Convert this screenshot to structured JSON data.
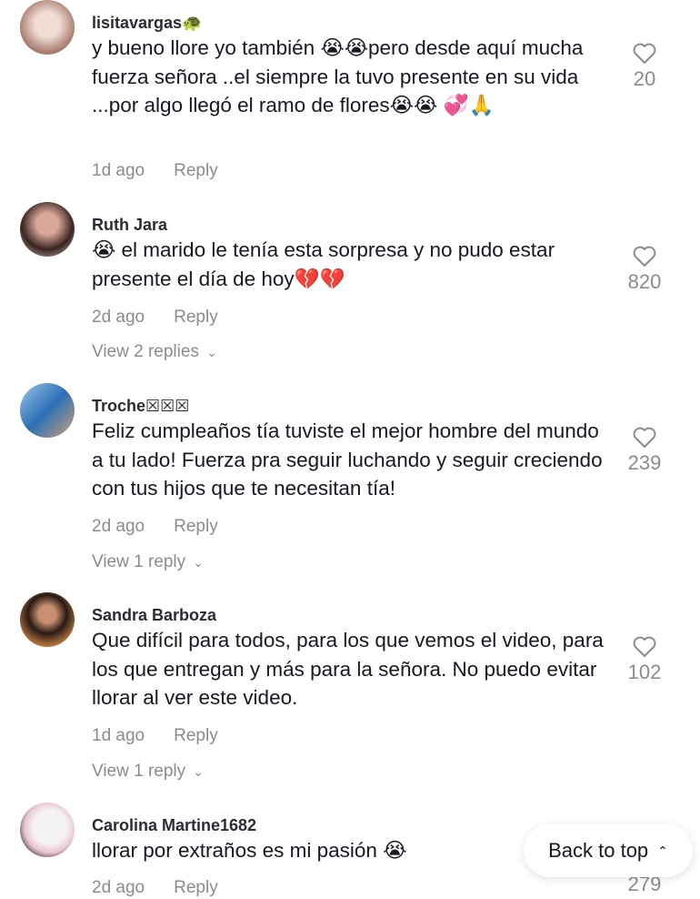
{
  "comments": [
    {
      "username": "lisitavargas🐢",
      "text": "y bueno llore yo también 😭😭pero desde aquí mucha fuerza señora ..el siempre la tuvo presente en su vida ...por algo llegó el ramo de flores😭😭 💞🙏",
      "time": "1d ago",
      "reply": "Reply",
      "likes": "20",
      "avatar_color": "#d9b8b0"
    },
    {
      "username": "Ruth Jara",
      "text": "😭 el marido le tenía esta sorpresa y no pudo estar presente el día de hoy💔💔",
      "time": "2d ago",
      "reply": "Reply",
      "likes": "820",
      "view_replies": "View 2 replies",
      "avatar_color": "#6b4a45"
    },
    {
      "username": "Troche☒☒☒",
      "text": "Feliz cumpleaños tía tuviste el mejor hombre del mundo a tu lado! Fuerza pra seguir luchando y seguir creciendo con tus hijos que te necesitan tía!",
      "time": "2d ago",
      "reply": "Reply",
      "likes": "239",
      "view_replies": "View 1 reply",
      "avatar_color": "#4a7fc0"
    },
    {
      "username": "Sandra Barboza",
      "text": "Que difícil para todos, para los que vemos el video, para los que entregan y más para la señora. No puedo evitar llorar al ver este video.",
      "time": "1d ago",
      "reply": "Reply",
      "likes": "102",
      "view_replies": "View 1 reply",
      "avatar_color": "#5a3a2a"
    },
    {
      "username": "Carolina Martine1682",
      "text": "llorar por extraños es mi pasión 😭",
      "time": "2d ago",
      "reply": "Reply",
      "likes": "279",
      "avatar_color": "#e8e4e6"
    }
  ],
  "back_to_top": "Back to top",
  "icons": {
    "like": "heart-outline-icon",
    "expand": "chevron-down-icon",
    "back": "double-chevron-up-icon"
  }
}
